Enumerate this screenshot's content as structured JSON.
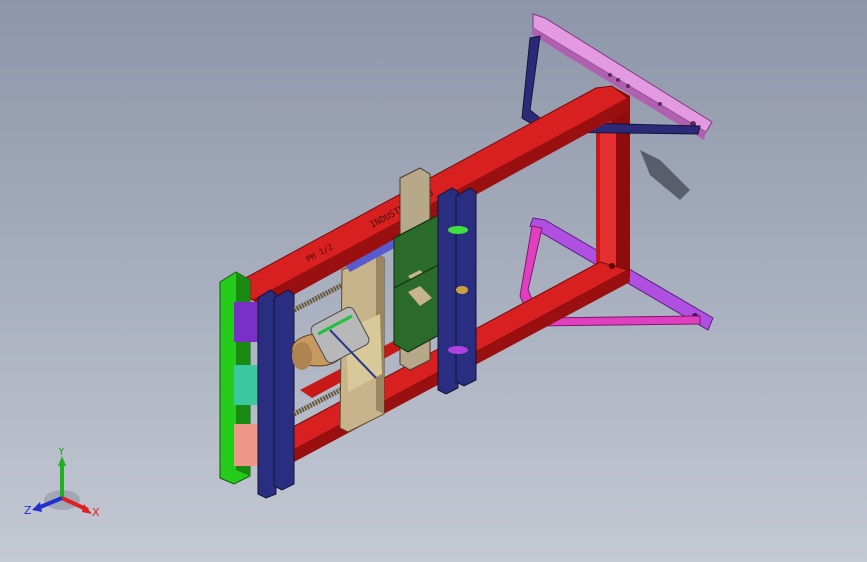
{
  "viewport": {
    "kind": "3d-cad-viewport",
    "background_top": "#8d96a9",
    "background_bottom": "#c4c9d3"
  },
  "model": {
    "frame_label": "INDUSTRY WOOD",
    "frame_label_small": "PH 1/2",
    "colors": {
      "frame_red": "#d61e1e",
      "wall_bracket_pink": "#e090d8",
      "strut_navy": "#2c2a70",
      "strut_purple": "#a040e0",
      "strut_magenta": "#e040c0",
      "front_plate_green": "#22c41a",
      "clamp_green": "#2a6a2a",
      "rail_blue": "#2a2e80",
      "carriage_tan": "#c8b48a",
      "motor_gold": "#c8a06a"
    }
  },
  "triad": {
    "x_label": "X",
    "y_label": "Y",
    "z_label": "Z",
    "x_color": "#e02020",
    "y_color": "#20b020",
    "z_color": "#2030d0"
  }
}
